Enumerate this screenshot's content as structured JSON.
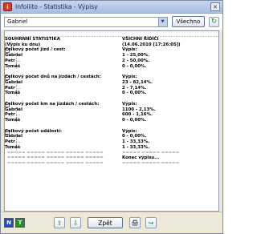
{
  "window": {
    "title": "Infoliito - Statistika - Výpisy"
  },
  "toolbar": {
    "select_value": "Gabriel",
    "all_button": "Všechno"
  },
  "report": {
    "rows": [
      {
        "left": "",
        "right": "",
        "type": "dash"
      },
      {
        "left": "SOUHRNNÍ STATISTIKA",
        "right": "VŠICHNI ŘIDIČI",
        "type": "top"
      },
      {
        "left": "(Výpis ku dnu)",
        "right": "(14.06.2010 [17:26:05])",
        "type": "top"
      },
      {
        "left": "Celkový počet jízd / cest:",
        "right": "Výpis:",
        "type": "section"
      },
      {
        "left": "Gabriel",
        "right": "1 - 25,00%.",
        "type": "child"
      },
      {
        "left": "Petr",
        "right": "2 - 50,00%.",
        "type": "child"
      },
      {
        "left": "Tomáš",
        "right": "0 - 0,00%.",
        "type": "child"
      },
      {
        "left": "",
        "right": "",
        "type": "blank"
      },
      {
        "left": "Celkový počet dnů na jízdách / cestách:",
        "right": "Výpis:",
        "type": "section"
      },
      {
        "left": "Gabriel",
        "right": "23 - 82,14%.",
        "type": "child"
      },
      {
        "left": "Petr",
        "right": "2 - 7,14%.",
        "type": "child"
      },
      {
        "left": "Tomáš",
        "right": "0 - 0,00%.",
        "type": "child"
      },
      {
        "left": "",
        "right": "",
        "type": "blank"
      },
      {
        "left": "Celkový počet km na jízdách / cestách:",
        "right": "Výpis:",
        "type": "section"
      },
      {
        "left": "Gabriel",
        "right": "1100 - 2,13%.",
        "type": "child"
      },
      {
        "left": "Petr",
        "right": "600 - 1,16%.",
        "type": "child"
      },
      {
        "left": "Tomáš",
        "right": "0 - 0,00%.",
        "type": "child"
      },
      {
        "left": "",
        "right": "",
        "type": "blank"
      },
      {
        "left": "Celkový počet událostí:",
        "right": "Výpis:",
        "type": "section"
      },
      {
        "left": "Gabriel",
        "right": "0 - 0,00%.",
        "type": "child"
      },
      {
        "left": "Petr",
        "right": "1 - 33,33%.",
        "type": "child"
      },
      {
        "left": "Tomáš",
        "right": "1 - 33,33%.",
        "type": "child"
      },
      {
        "left": "===== ===== ===== ===== =====",
        "right": "===== ===== =====",
        "type": "rule"
      },
      {
        "left": "===== ===== ===== ===== =====",
        "right": "Konec výpisu...",
        "type": "end"
      },
      {
        "left": "===== ===== ===== ===== =====",
        "right": "===== ===== =====",
        "type": "rule"
      }
    ]
  },
  "footer": {
    "back_button": "Zpět"
  }
}
